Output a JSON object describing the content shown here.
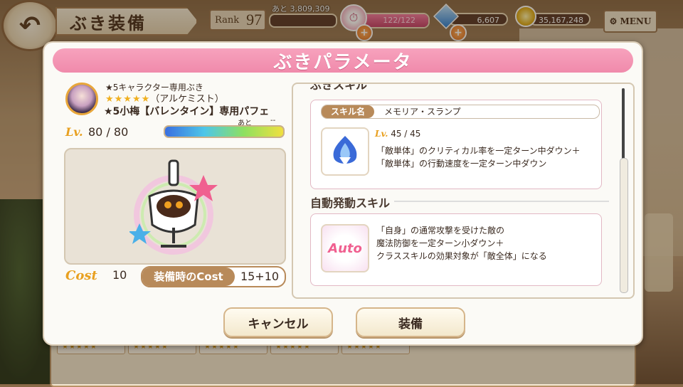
{
  "topbar": {
    "back_icon": "back-arrow-icon",
    "title": "ぶき装備",
    "rank_label": "Rank",
    "rank_value": "97",
    "next_exp_label": "あと 3,809,309",
    "stamina_text": "122/122",
    "stamina_ratio": 1.0,
    "gems": "6,607",
    "coins": "35,167,248",
    "menu_label": "MENU",
    "menu_icon": "gear-icon"
  },
  "dialog": {
    "title": "ぶきパラメータ",
    "item": {
      "rarity_line": "★5キャラクター専用ぶき",
      "stars": "★★★★★",
      "class_line": "（アルケミスト）",
      "name": "★5小梅【バレンタイン】専用パフェ",
      "lv_label": "Lv.",
      "lv_value": "80 / 80",
      "next_label": "あと",
      "next_value": "--",
      "cost_label": "Cost",
      "cost_value": "10",
      "equip_cost_label": "装備時のCost",
      "equip_cost_value": "15+10"
    },
    "cut_heading": "ぶきスキル",
    "skill": {
      "name_tag": "スキル名",
      "name": "メモリア・スランプ",
      "lv_label": "Lv.",
      "lv_value": "45 / 45",
      "desc1": "「敵単体」のクリティカル率を一定ターン中ダウン＋",
      "desc2": "「敵単体」の行動速度を一定ターン中ダウン"
    },
    "auto_section": "自動発動スキル",
    "auto_skill": {
      "icon_text": "Auto",
      "desc1": "「自身」の通常攻撃を受けた敵の",
      "desc2": "魔法防御を一定ターン小ダウン＋",
      "desc3": "クラススキルの効果対象が「敵全体」になる"
    },
    "cancel_label": "キャンセル",
    "equip_label": "装備"
  },
  "background": {
    "card_stars": "★★★★★"
  }
}
